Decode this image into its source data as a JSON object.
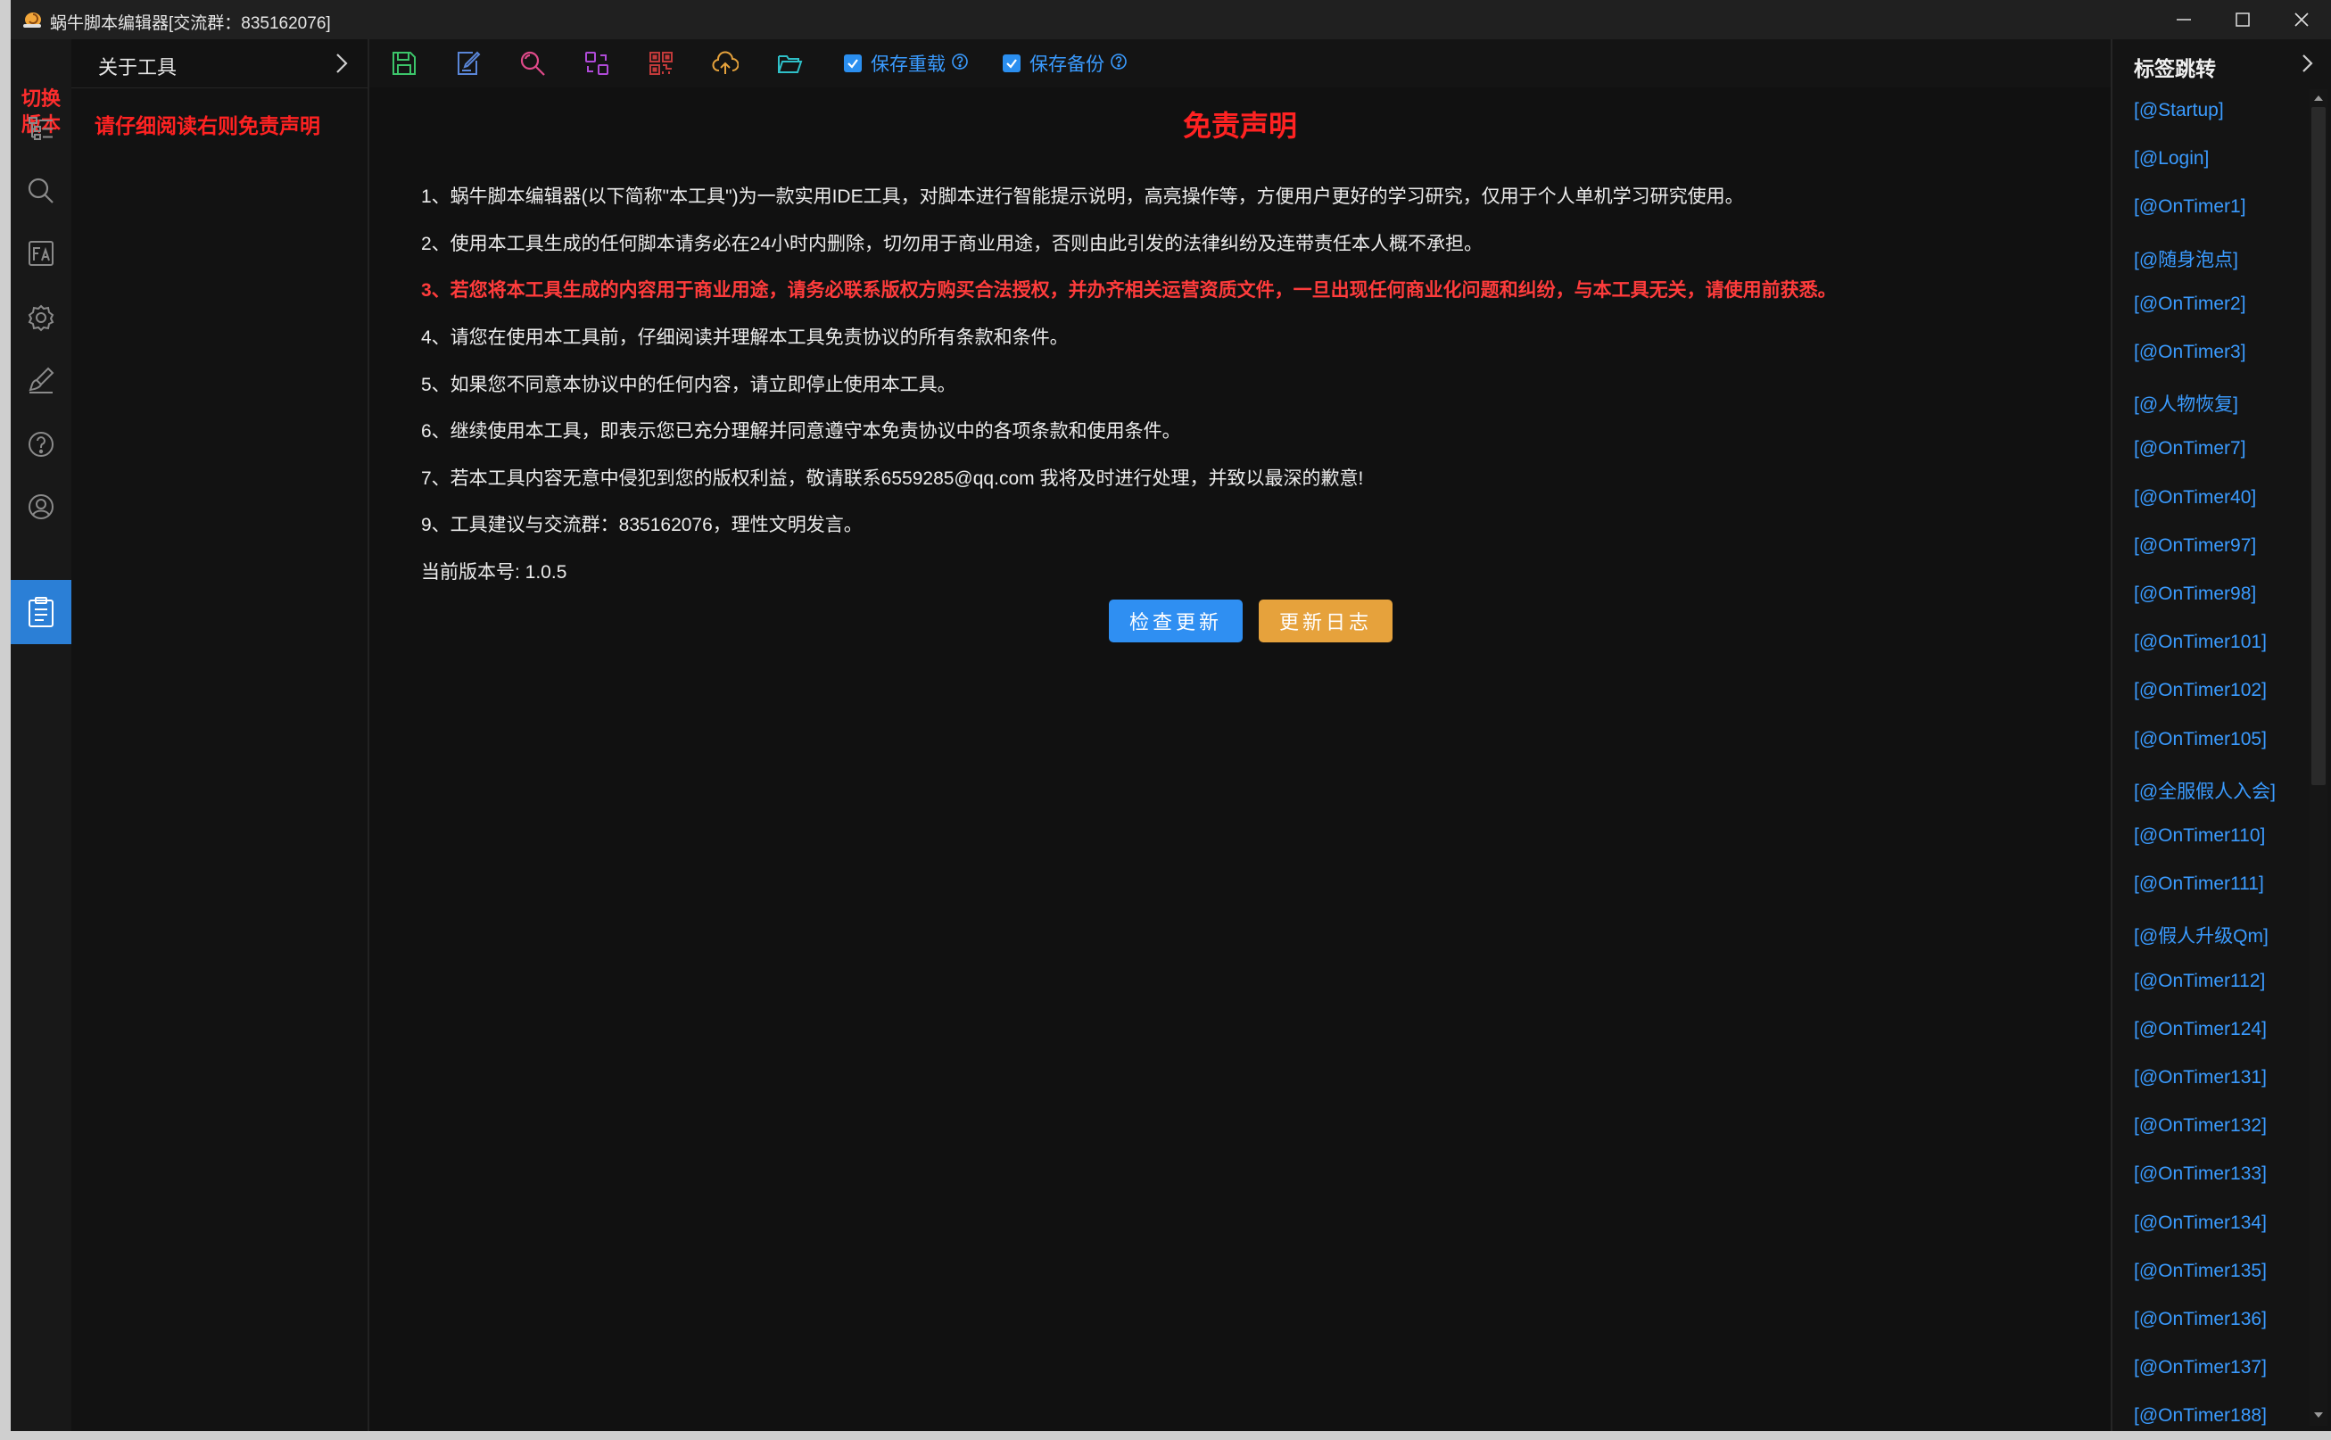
{
  "window": {
    "title": "蜗牛脚本编辑器[交流群：835162076]"
  },
  "rail": {
    "switch_version": [
      "切换",
      "版本"
    ],
    "icons": [
      "tree-list-icon",
      "search-icon",
      "font-icon",
      "gear-icon",
      "brush-icon",
      "help-icon",
      "user-icon",
      "clipboard-icon"
    ],
    "active": "clipboard-icon"
  },
  "panel": {
    "title": "关于工具",
    "notice": "请仔细阅读右则免责声明"
  },
  "toolbar": {
    "icons": [
      "save-icon",
      "edit-icon",
      "search-icon",
      "compare-icon",
      "qr-icon",
      "cloud-upload-icon",
      "folder-icon"
    ],
    "save_reload_label": "保存重载",
    "save_backup_label": "保存备份"
  },
  "content": {
    "title": "免责声明",
    "paragraphs": [
      "1、蜗牛脚本编辑器(以下简称\"本工具\")为一款实用IDE工具，对脚本进行智能提示说明，高亮操作等，方便用户更好的学习研究，仅用于个人单机学习研究使用。",
      "2、使用本工具生成的任何脚本请务必在24小时内删除，切勿用于商业用途，否则由此引发的法律纠纷及连带责任本人概不承担。",
      "3、若您将本工具生成的内容用于商业用途，请务必联系版权方购买合法授权，并办齐相关运营资质文件，一旦出现任何商业化问题和纠纷，与本工具无关，请使用前获悉。",
      "4、请您在使用本工具前，仔细阅读并理解本工具免责协议的所有条款和条件。",
      "5、如果您不同意本协议中的任何内容，请立即停止使用本工具。",
      "6、继续使用本工具，即表示您已充分理解并同意遵守本免责协议中的各项条款和使用条件。",
      "7、若本工具内容无意中侵犯到您的版权利益，敬请联系6559285@qq.com 我将及时进行处理，并致以最深的歉意!",
      "9、工具建议与交流群：835162076，理性文明发言。",
      "当前版本号: 1.0.5"
    ],
    "check_update_label": "检查更新",
    "changelog_label": "更新日志"
  },
  "bookmarks": {
    "title": "标签跳转",
    "items": [
      "[@Startup]",
      "[@Login]",
      "[@OnTimer1]",
      "[@随身泡点]",
      "[@OnTimer2]",
      "[@OnTimer3]",
      "[@人物恢复]",
      "[@OnTimer7]",
      "[@OnTimer40]",
      "[@OnTimer97]",
      "[@OnTimer98]",
      "[@OnTimer101]",
      "[@OnTimer102]",
      "[@OnTimer105]",
      "[@全服假人入会]",
      "[@OnTimer110]",
      "[@OnTimer111]",
      "[@假人升级Qm]",
      "[@OnTimer112]",
      "[@OnTimer124]",
      "[@OnTimer131]",
      "[@OnTimer132]",
      "[@OnTimer133]",
      "[@OnTimer134]",
      "[@OnTimer135]",
      "[@OnTimer136]",
      "[@OnTimer137]",
      "[@OnTimer188]"
    ]
  },
  "colors": {
    "accent": "#2f8ff2",
    "warning": "#e6a23c",
    "danger": "#ff2222",
    "link": "#3a9bff"
  }
}
